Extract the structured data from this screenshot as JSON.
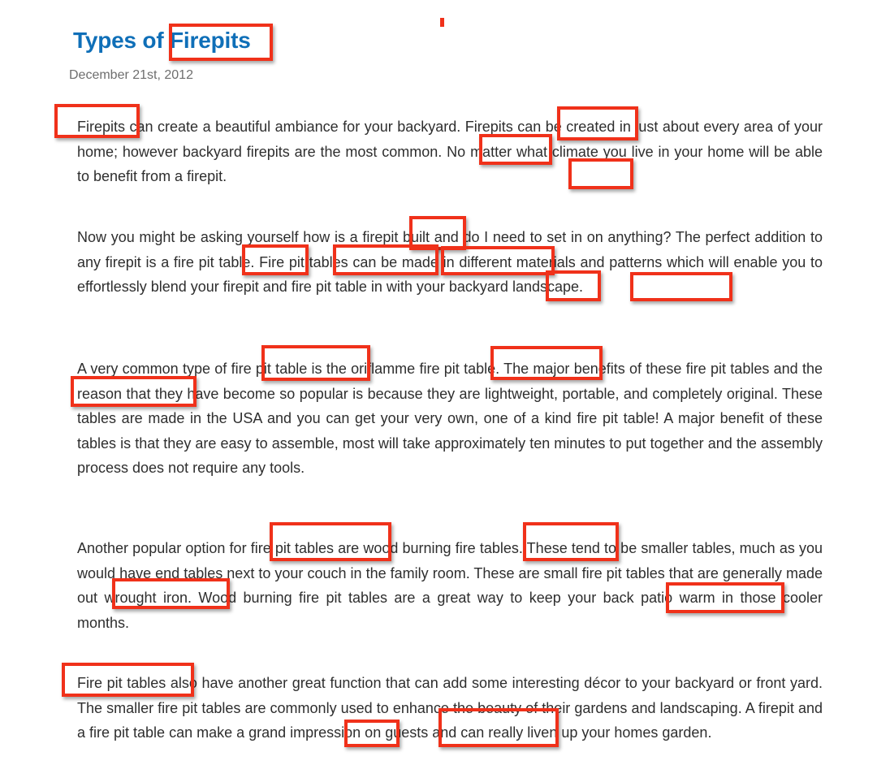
{
  "article": {
    "title": "Types of Firepits",
    "date": "December 21st, 2012",
    "paragraphs": [
      "Firepits can create a beautiful ambiance for your backyard. Firepits can be created in just about every area of your home; however backyard firepits are the most common. No matter what climate you live in your home will be able to benefit from a firepit.",
      "Now you might be asking yourself how is a firepit built and do I need to set in on anything? The perfect addition to any firepit is a fire pit table. Fire pit tables can be made in different materials and patterns which will enable you to effortlessly blend your firepit and fire pit table in with your backyard landscape.",
      "A very common type of fire pit table is the oriflamme fire pit table. The major benefits of these fire pit tables and the reason that they have become so popular is because they are lightweight, portable, and completely original. These tables are made in the USA and you can get your very own, one of a kind fire pit table! A major benefit of these tables is that they are easy to assemble, most will take approximately ten minutes to put together and the assembly process does not require any tools.",
      "Another popular option for fire pit tables are wood burning fire tables.  These tend to be smaller tables, much as you would have end tables next to your couch in the family room. These are small fire pit tables that are generally made out wrought iron. Wood burning fire pit tables are a great way to keep your back patio warm in those cooler months.",
      "Fire pit tables also have another great function that can add some interesting décor to your backyard or front yard. The smaller fire pit tables are commonly used to enhance the beauty of their gardens and landscaping. A firepit and a fire pit table can make a grand impression on guests and can really liven up your homes garden."
    ]
  },
  "annotations": {
    "highlight_color": "#f0311a",
    "highlighted_keywords": [
      {
        "paragraph": "title",
        "text": "Firepits"
      },
      {
        "paragraph": 1,
        "text": "Firepits"
      },
      {
        "paragraph": 1,
        "text": "Firepits"
      },
      {
        "paragraph": 1,
        "text": "firepits"
      },
      {
        "paragraph": 1,
        "text": "firepit."
      },
      {
        "paragraph": 2,
        "text": "firepit"
      },
      {
        "paragraph": 2,
        "text": "firepit"
      },
      {
        "paragraph": 2,
        "text": "fire pit table."
      },
      {
        "paragraph": 2,
        "text": "Fire pit tables"
      },
      {
        "paragraph": 2,
        "text": "firepit"
      },
      {
        "paragraph": 2,
        "text": "fire pit table"
      },
      {
        "paragraph": 3,
        "text": "fire pit table"
      },
      {
        "paragraph": 3,
        "text": "fire pit table."
      },
      {
        "paragraph": 3,
        "text": "fire pit tables"
      },
      {
        "paragraph": 4,
        "text": "fire pit tables"
      },
      {
        "paragraph": 4,
        "text": "fire tables."
      },
      {
        "paragraph": 4,
        "text": "fire pit tables"
      },
      {
        "paragraph": 4,
        "text": "fire pit tables"
      },
      {
        "paragraph": 5,
        "text": "Fire pit tables"
      },
      {
        "paragraph": 5,
        "text": "firepit"
      },
      {
        "paragraph": 5,
        "text": "fire pit table"
      }
    ]
  }
}
